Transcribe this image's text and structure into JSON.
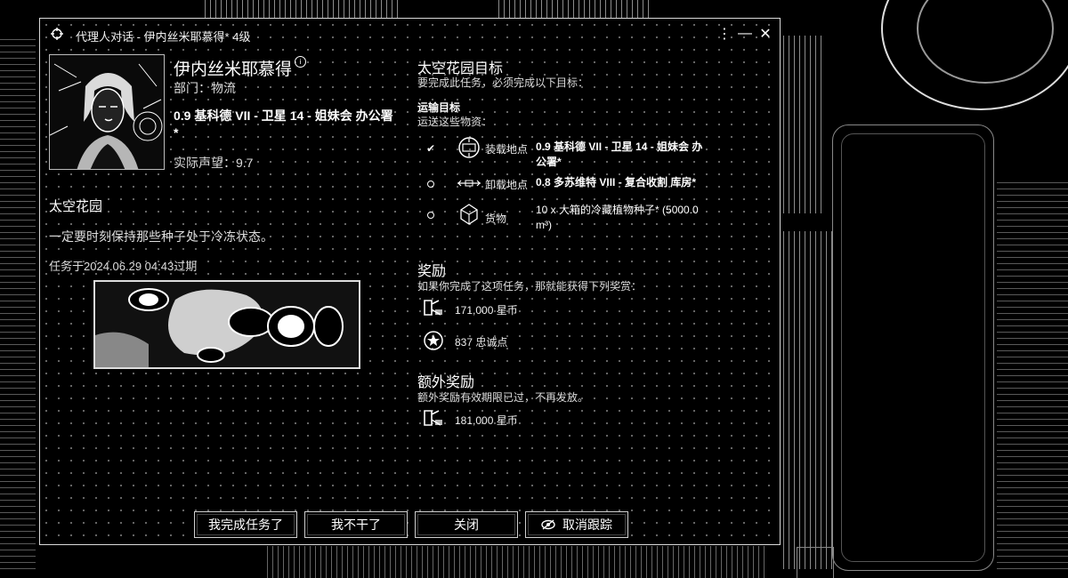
{
  "window": {
    "title": "代理人对话 - 伊内丝米耶慕得* 4级",
    "controls": [
      "⋮",
      "—",
      "✕"
    ]
  },
  "agent": {
    "name": "伊内丝米耶慕得",
    "department": "部门：物流",
    "location": "0.9 基科德 VII - 卫星 14 - 姐妹会 办公署*",
    "standing": "实际声望：9.7"
  },
  "mission": {
    "name": "太空花园",
    "description": "一定要时刻保持那些种子处于冷冻状态。",
    "expiry": "任务于2024.06.29 04:43过期"
  },
  "objectives": {
    "heading": "太空花园目标",
    "subheading": "要完成此任务，必须完成以下目标：",
    "transport_heading": "运输目标",
    "transport_sub": "运送这些物资：",
    "items": [
      {
        "label": "装载地点",
        "value": "0.9 基科德 VII - 卫星 14 - 姐妹会 办公署*",
        "status": "complete",
        "icon": "pickup-icon"
      },
      {
        "label": "卸载地点",
        "value": "0.8 多苏维特 VIII - 复合收割 库房*",
        "status": "pending",
        "icon": "dropoff-icon"
      },
      {
        "label": "货物",
        "value": "10 x 大箱的冷藏植物种子* (5000.0 m³)",
        "status": "pending",
        "icon": "cargo-icon"
      }
    ]
  },
  "rewards": {
    "heading": "奖励",
    "subheading": "如果你完成了这项任务，那就能获得下列奖赏：",
    "items": [
      {
        "text": "171,000 星币",
        "icon": "isk-icon"
      },
      {
        "text": "837 忠诚点",
        "icon": "loyalty-points-icon"
      }
    ]
  },
  "bonus_rewards": {
    "heading": "额外奖励",
    "subheading": "额外奖励有效期限已过，不再发放。",
    "items": [
      {
        "text": "181,000 星币",
        "icon": "isk-icon"
      }
    ]
  },
  "buttons": {
    "complete": "我完成任务了",
    "quit": "我不干了",
    "close": "关闭",
    "untrack": "取消跟踪"
  }
}
